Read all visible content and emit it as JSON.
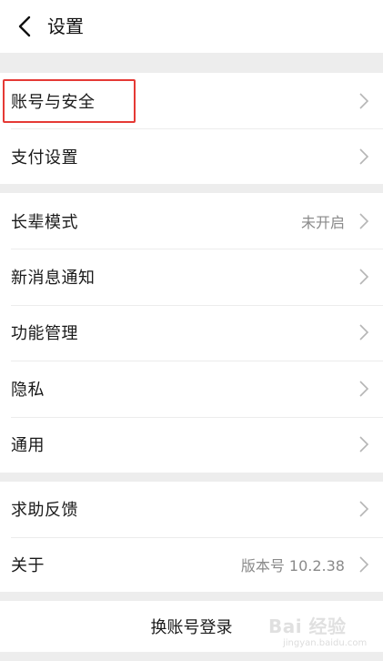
{
  "header": {
    "title": "设置",
    "back_icon": "chevron-left-icon"
  },
  "groups": {
    "account": {
      "items": [
        {
          "label": "账号与安全",
          "value": ""
        },
        {
          "label": "支付设置",
          "value": ""
        }
      ]
    },
    "general": {
      "items": [
        {
          "label": "长辈模式",
          "value": "未开启"
        },
        {
          "label": "新消息通知",
          "value": ""
        },
        {
          "label": "功能管理",
          "value": ""
        },
        {
          "label": "隐私",
          "value": ""
        },
        {
          "label": "通用",
          "value": ""
        }
      ]
    },
    "about": {
      "items": [
        {
          "label": "求助反馈",
          "value": ""
        },
        {
          "label": "关于",
          "value": "版本号 10.2.38"
        }
      ]
    }
  },
  "footer": {
    "switch_account_label": "换账号登录"
  },
  "watermark": {
    "text": "Bai 经验",
    "subtext": "jingyan.baidu.com"
  },
  "colors": {
    "background": "#ededed",
    "highlight_box": "#e53935",
    "secondary_text": "#8a8a8a"
  }
}
